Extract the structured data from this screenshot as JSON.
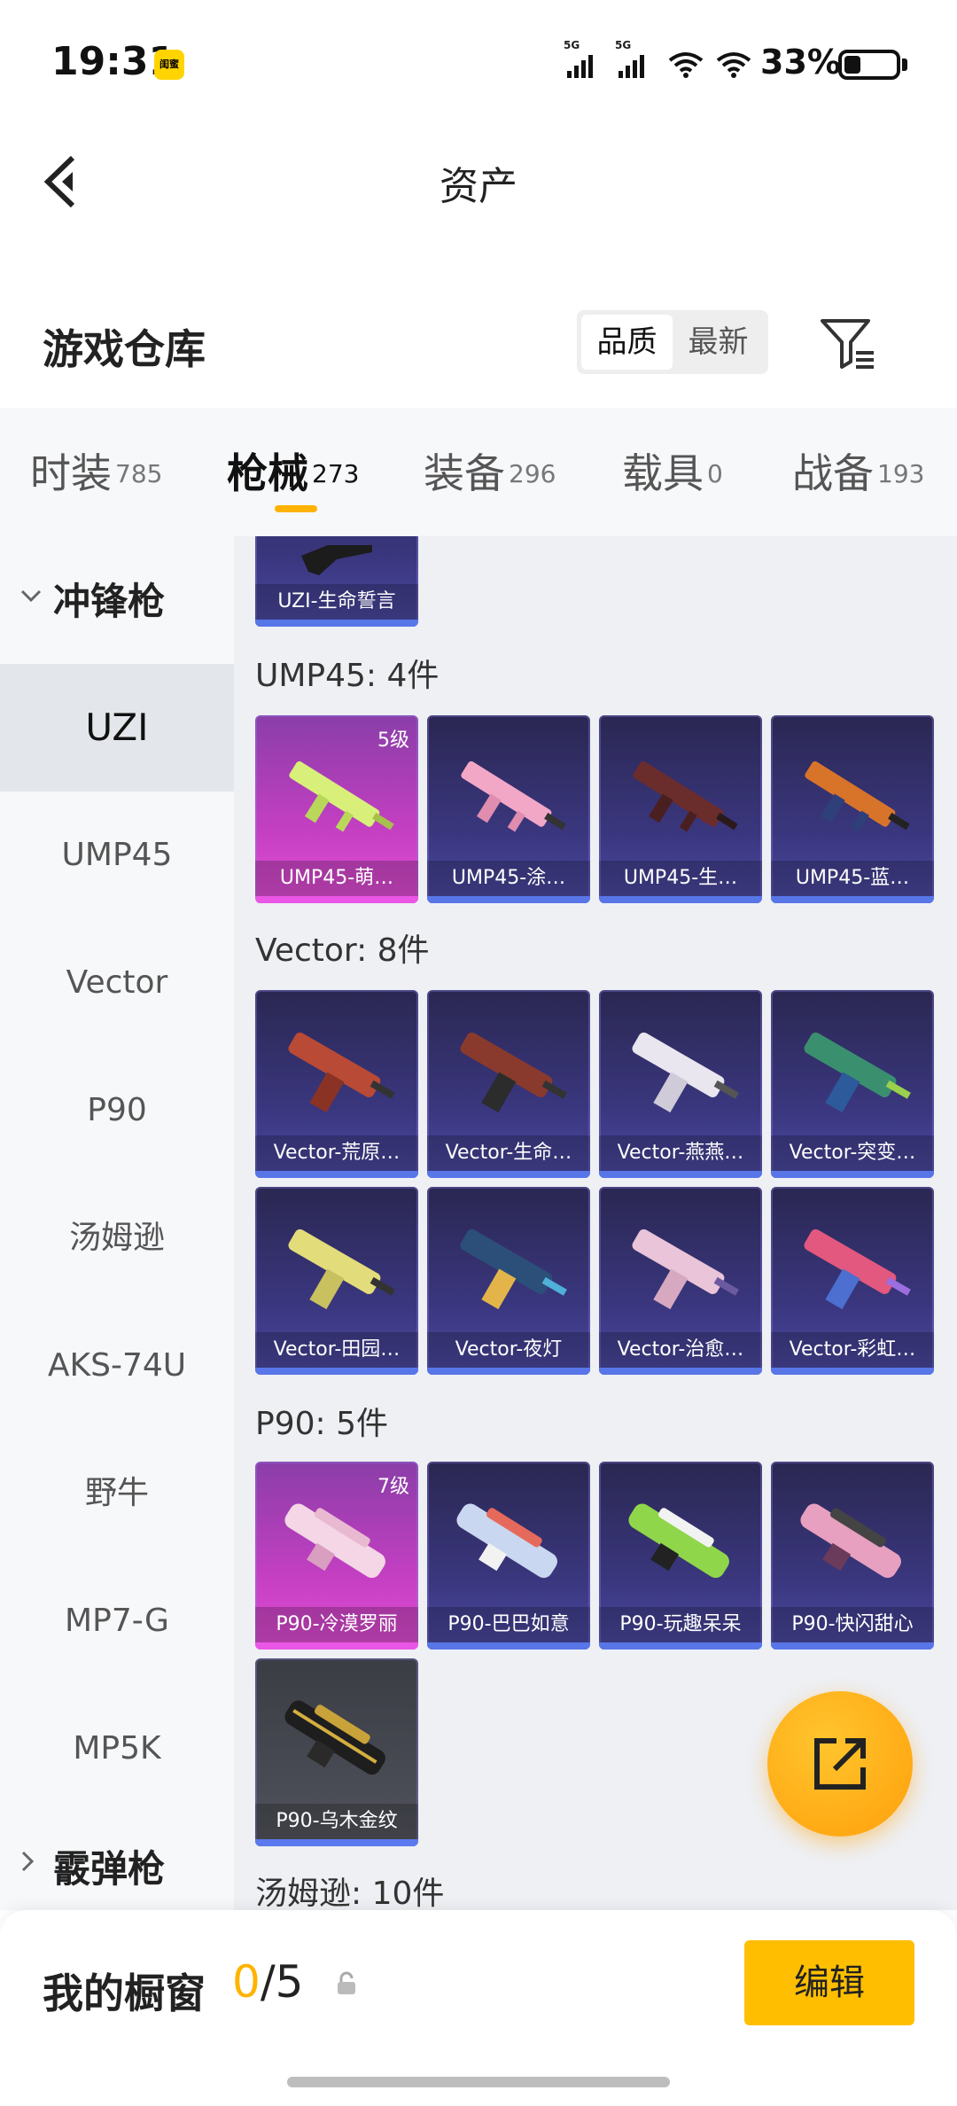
{
  "status": {
    "time": "19:31",
    "badge": "闺蜜",
    "sim1": "5G",
    "sim2": "5G",
    "battery_pct": "33%",
    "battery_level": 0.33
  },
  "app_bar": {
    "title": "资产"
  },
  "warehouse": {
    "title": "游戏仓库",
    "sort_options": [
      "品质",
      "最新"
    ],
    "sort_selected": "品质"
  },
  "tabs": [
    {
      "label": "时装",
      "count": "785"
    },
    {
      "label": "枪械",
      "count": "273",
      "active": true
    },
    {
      "label": "装备",
      "count": "296"
    },
    {
      "label": "载具",
      "count": "0"
    },
    {
      "label": "战备",
      "count": "193"
    }
  ],
  "sidebar": {
    "group_smg": "冲锋枪",
    "items": [
      "UZI",
      "UMP45",
      "Vector",
      "P90",
      "汤姆逊",
      "AKS-74U",
      "野牛",
      "MP7-G",
      "MP5K"
    ],
    "active_item": "UZI",
    "group_shotgun": "霰弹枪"
  },
  "content": {
    "uzi_partial": {
      "name": "UZI-生命誓言"
    },
    "sections": [
      {
        "title": "UMP45: 4件",
        "cards": [
          {
            "name": "UMP45-萌…",
            "level": "5级",
            "rarity": "pink"
          },
          {
            "name": "UMP45-涂…",
            "rarity": "purple"
          },
          {
            "name": "UMP45-生…",
            "rarity": "purple"
          },
          {
            "name": "UMP45-蓝…",
            "rarity": "purple"
          }
        ]
      },
      {
        "title": "Vector: 8件",
        "cards": [
          {
            "name": "Vector-荒原…",
            "rarity": "purple"
          },
          {
            "name": "Vector-生命…",
            "rarity": "purple"
          },
          {
            "name": "Vector-燕燕…",
            "rarity": "purple"
          },
          {
            "name": "Vector-突变…",
            "rarity": "purple"
          },
          {
            "name": "Vector-田园…",
            "rarity": "purple"
          },
          {
            "name": "Vector-夜灯",
            "rarity": "purple"
          },
          {
            "name": "Vector-治愈…",
            "rarity": "purple"
          },
          {
            "name": "Vector-彩虹…",
            "rarity": "purple"
          }
        ]
      },
      {
        "title": "P90: 5件",
        "cards": [
          {
            "name": "P90-冷漠罗丽",
            "level": "7级",
            "rarity": "pink"
          },
          {
            "name": "P90-巴巴如意",
            "rarity": "purple"
          },
          {
            "name": "P90-玩趣呆呆",
            "rarity": "purple"
          },
          {
            "name": "P90-快闪甜心",
            "rarity": "purple"
          },
          {
            "name": "P90-乌木金纹",
            "rarity": "grey"
          }
        ]
      },
      {
        "title": "汤姆逊: 10件",
        "cards": []
      }
    ]
  },
  "bottom": {
    "showcase_label": "我的橱窗",
    "showcase_current": "0",
    "showcase_total": "/5",
    "edit_label": "编辑"
  },
  "colors": {
    "accent": "#ffb300",
    "edit_button": "#ffbf00",
    "card_purple": "#3b3780",
    "card_pink": "#c33fc2",
    "card_grey": "#4a4c55"
  }
}
